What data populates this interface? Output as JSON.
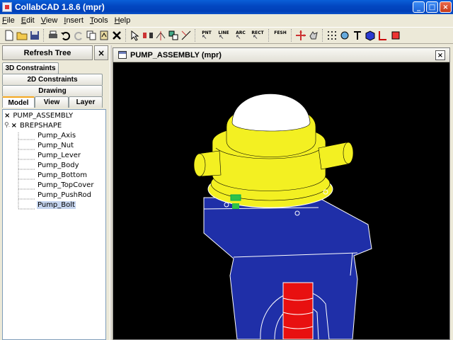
{
  "window": {
    "title": "CollabCAD 1.8.6 (mpr)",
    "minimize": "_",
    "maximize": "□",
    "close": "×"
  },
  "menu": [
    {
      "label": "File",
      "u": "F",
      "rest": "ile"
    },
    {
      "label": "Edit",
      "u": "E",
      "rest": "dit"
    },
    {
      "label": "View",
      "u": "V",
      "rest": "iew"
    },
    {
      "label": "Insert",
      "u": "I",
      "rest": "nsert"
    },
    {
      "label": "Tools",
      "u": "T",
      "rest": "ools"
    },
    {
      "label": "Help",
      "u": "H",
      "rest": "elp"
    }
  ],
  "toolbar": {
    "pnt_label": "PNT",
    "line_label": "LINE",
    "arc_label": "ARC",
    "rect_label": "RECT",
    "fesh_label": "FESH"
  },
  "left_panel": {
    "refresh_label": "Refresh Tree",
    "close_label": "×",
    "tabs_row1": [
      "3D Constraints"
    ],
    "tabs_row2": [
      "2D Constraints"
    ],
    "tabs_row3": [
      "Drawing"
    ],
    "tabs_row4": [
      "Model",
      "View",
      "Layer"
    ]
  },
  "tree": {
    "root": "PUMP_ASSEMBLY",
    "child": "BREPSHAPE",
    "leaves": [
      "Pump_Axis",
      "Pump_Nut",
      "Pump_Lever",
      "Pump_Body",
      "Pump_Bottom",
      "Pump_TopCover",
      "Pump_PushRod",
      "Pump_Bolt"
    ],
    "selected_index": 7,
    "x_mark": "×"
  },
  "frame": {
    "title": "PUMP_ASSEMBLY (mpr)",
    "close": "×"
  },
  "colors": {
    "viewport_bg": "#000000",
    "body_blue": "#1f2fa8",
    "cover_yellow": "#f3f022",
    "cap_white": "#ffffff",
    "rod_red": "#e81010",
    "bolt_green": "#2ec24a"
  }
}
